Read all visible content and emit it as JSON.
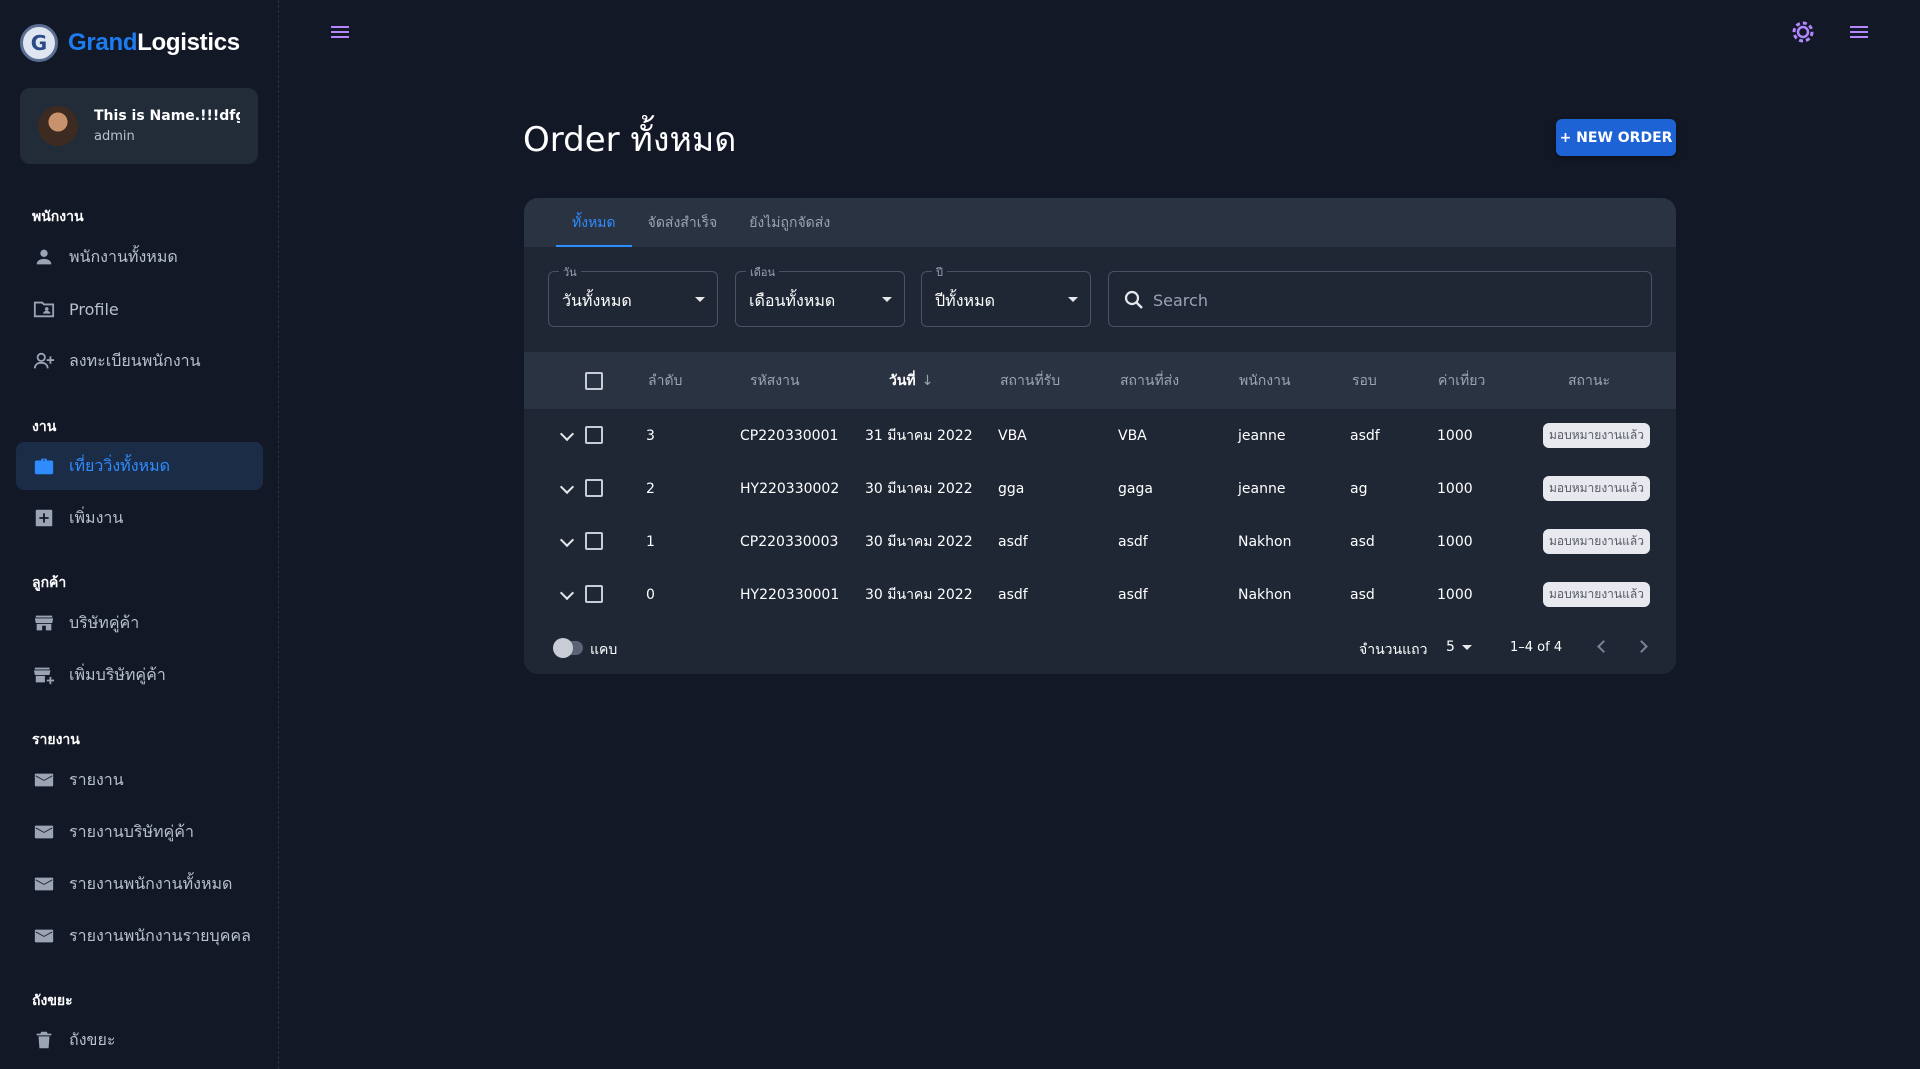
{
  "brand": {
    "name_part1": "Grand",
    "name_part2": "Logistics",
    "logo_letter": "G"
  },
  "user": {
    "name": "This is Name.!!!dfgsdfg...",
    "role": "admin"
  },
  "sidebar": {
    "sections": [
      {
        "title": "พนักงาน",
        "items": [
          {
            "label": "พนักงานทั้งหมด",
            "icon": "person-icon"
          },
          {
            "label": "Profile",
            "icon": "folder-person-icon"
          },
          {
            "label": "ลงทะเบียนพนักงาน",
            "icon": "person-add-icon"
          }
        ]
      },
      {
        "title": "งาน",
        "items": [
          {
            "label": "เที่ยววิ่งทั้งหมด",
            "icon": "briefcase-icon",
            "active": true
          },
          {
            "label": "เพิ่มงาน",
            "icon": "add-box-icon"
          }
        ]
      },
      {
        "title": "ลูกค้า",
        "items": [
          {
            "label": "บริษัทคู่ค้า",
            "icon": "store-icon"
          },
          {
            "label": "เพิ่มบริษัทคู่ค้า",
            "icon": "add-store-icon"
          }
        ]
      },
      {
        "title": "รายงาน",
        "items": [
          {
            "label": "รายงาน",
            "icon": "mail-icon"
          },
          {
            "label": "รายงานบริษัทคู่ค้า",
            "icon": "mail-icon"
          },
          {
            "label": "รายงานพนักงานทั้งหมด",
            "icon": "mail-icon"
          },
          {
            "label": "รายงานพนักงานรายบุคคล",
            "icon": "mail-icon"
          }
        ]
      },
      {
        "title": "ถังขยะ",
        "items": [
          {
            "label": "ถังขยะ",
            "icon": "trash-icon"
          }
        ]
      }
    ]
  },
  "page": {
    "title": "Order ทั้งหมด",
    "new_order_label": "+ NEW ORDER"
  },
  "tabs": [
    "ทั้งหมด",
    "จัดส่งสำเร็จ",
    "ยังไม่ถูกจัดส่ง"
  ],
  "filters": {
    "day": {
      "label": "วัน",
      "value": "วันทั้งหมด"
    },
    "month": {
      "label": "เดือน",
      "value": "เดือนทั้งหมด"
    },
    "year": {
      "label": "ปี",
      "value": "ปีทั้งหมด"
    },
    "search_placeholder": "Search"
  },
  "table": {
    "columns": [
      "ลำดับ",
      "รหัสงาน",
      "วันที่",
      "สถานที่รับ",
      "สถานที่ส่ง",
      "พนักงาน",
      "รอบ",
      "ค่าเที่ยว",
      "สถานะ"
    ],
    "sort_indicator": "↓",
    "rows": [
      {
        "no": "3",
        "code": "CP220330001",
        "date": "31 มีนาคม 2022",
        "pickup": "VBA",
        "dropoff": "VBA",
        "staff": "jeanne",
        "round": "asdf",
        "fee": "1000",
        "status": "มอบหมายงานแล้ว"
      },
      {
        "no": "2",
        "code": "HY220330002",
        "date": "30 มีนาคม 2022",
        "pickup": "gga",
        "dropoff": "gaga",
        "staff": "jeanne",
        "round": "ag",
        "fee": "1000",
        "status": "มอบหมายงานแล้ว"
      },
      {
        "no": "1",
        "code": "CP220330003",
        "date": "30 มีนาคม 2022",
        "pickup": "asdf",
        "dropoff": "asdf",
        "staff": "Nakhon",
        "round": "asd",
        "fee": "1000",
        "status": "มอบหมายงานแล้ว"
      },
      {
        "no": "0",
        "code": "HY220330001",
        "date": "30 มีนาคม 2022",
        "pickup": "asdf",
        "dropoff": "asdf",
        "staff": "Nakhon",
        "round": "asd",
        "fee": "1000",
        "status": "มอบหมายงานแล้ว"
      }
    ]
  },
  "footer": {
    "dense_label": "แคบ",
    "rows_per_page_label": "จำนวนแถว",
    "rows_per_page": "5",
    "page_info": "1–4 of 4"
  },
  "colors": {
    "background": "#121826",
    "card": "#1f2735",
    "accent": "#2f8cff",
    "button": "#1e63d6",
    "brand_blue": "#1d7cf2"
  }
}
